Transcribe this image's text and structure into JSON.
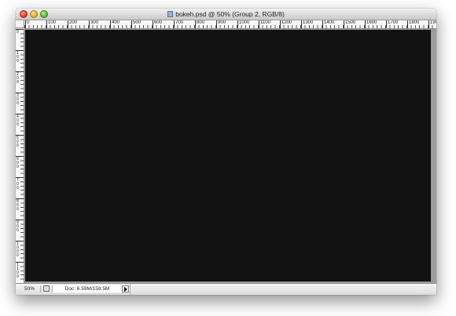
{
  "window": {
    "title": "bokeh.psd @ 50% (Group 2, RGB/8)",
    "controls": [
      "close-icon",
      "minimize-icon",
      "zoom-icon"
    ],
    "title_icon": "photoshop-document-icon"
  },
  "rulers": {
    "top_labels": [
      "0",
      "100",
      "200",
      "300",
      "400",
      "500",
      "600",
      "700",
      "800",
      "900",
      "1000",
      "1100",
      "1200",
      "1300",
      "1400",
      "1500",
      "1600",
      "1700",
      "1800",
      "190"
    ],
    "left_labels": [
      "0",
      "1 0 0",
      "2 0 0",
      "3 0 0",
      "4 0 0",
      "5 0 0",
      "6 0 0",
      "7 0 0",
      "8 0 0",
      "9 0 0",
      "1 0 0 0",
      "1 1 0 0"
    ]
  },
  "canvas": {
    "fill_color": "#121212"
  },
  "statusbar": {
    "zoom": "50%",
    "doc_info": "Doc: 6.59M/159.5M",
    "status_icon": "preview-icon",
    "menu_icon": "triangle-right-icon"
  }
}
